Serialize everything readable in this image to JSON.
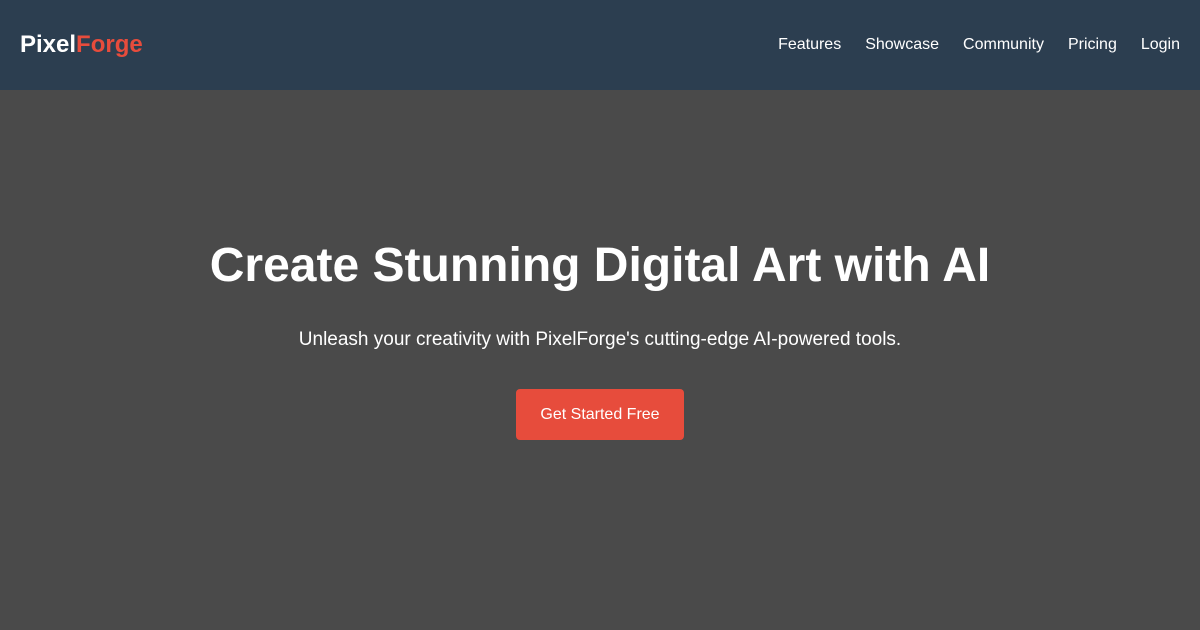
{
  "header": {
    "logo": {
      "part1": "Pixel",
      "part2": "Forge"
    },
    "nav": [
      "Features",
      "Showcase",
      "Community",
      "Pricing",
      "Login"
    ]
  },
  "hero": {
    "title": "Create Stunning Digital Art with AI",
    "subtitle": "Unleash your creativity with PixelForge's cutting-edge AI-powered tools.",
    "cta_label": "Get Started Free"
  },
  "colors": {
    "header_bg": "#2c3e50",
    "hero_bg": "#4a4a4a",
    "accent": "#e74c3c",
    "text": "#ffffff"
  }
}
